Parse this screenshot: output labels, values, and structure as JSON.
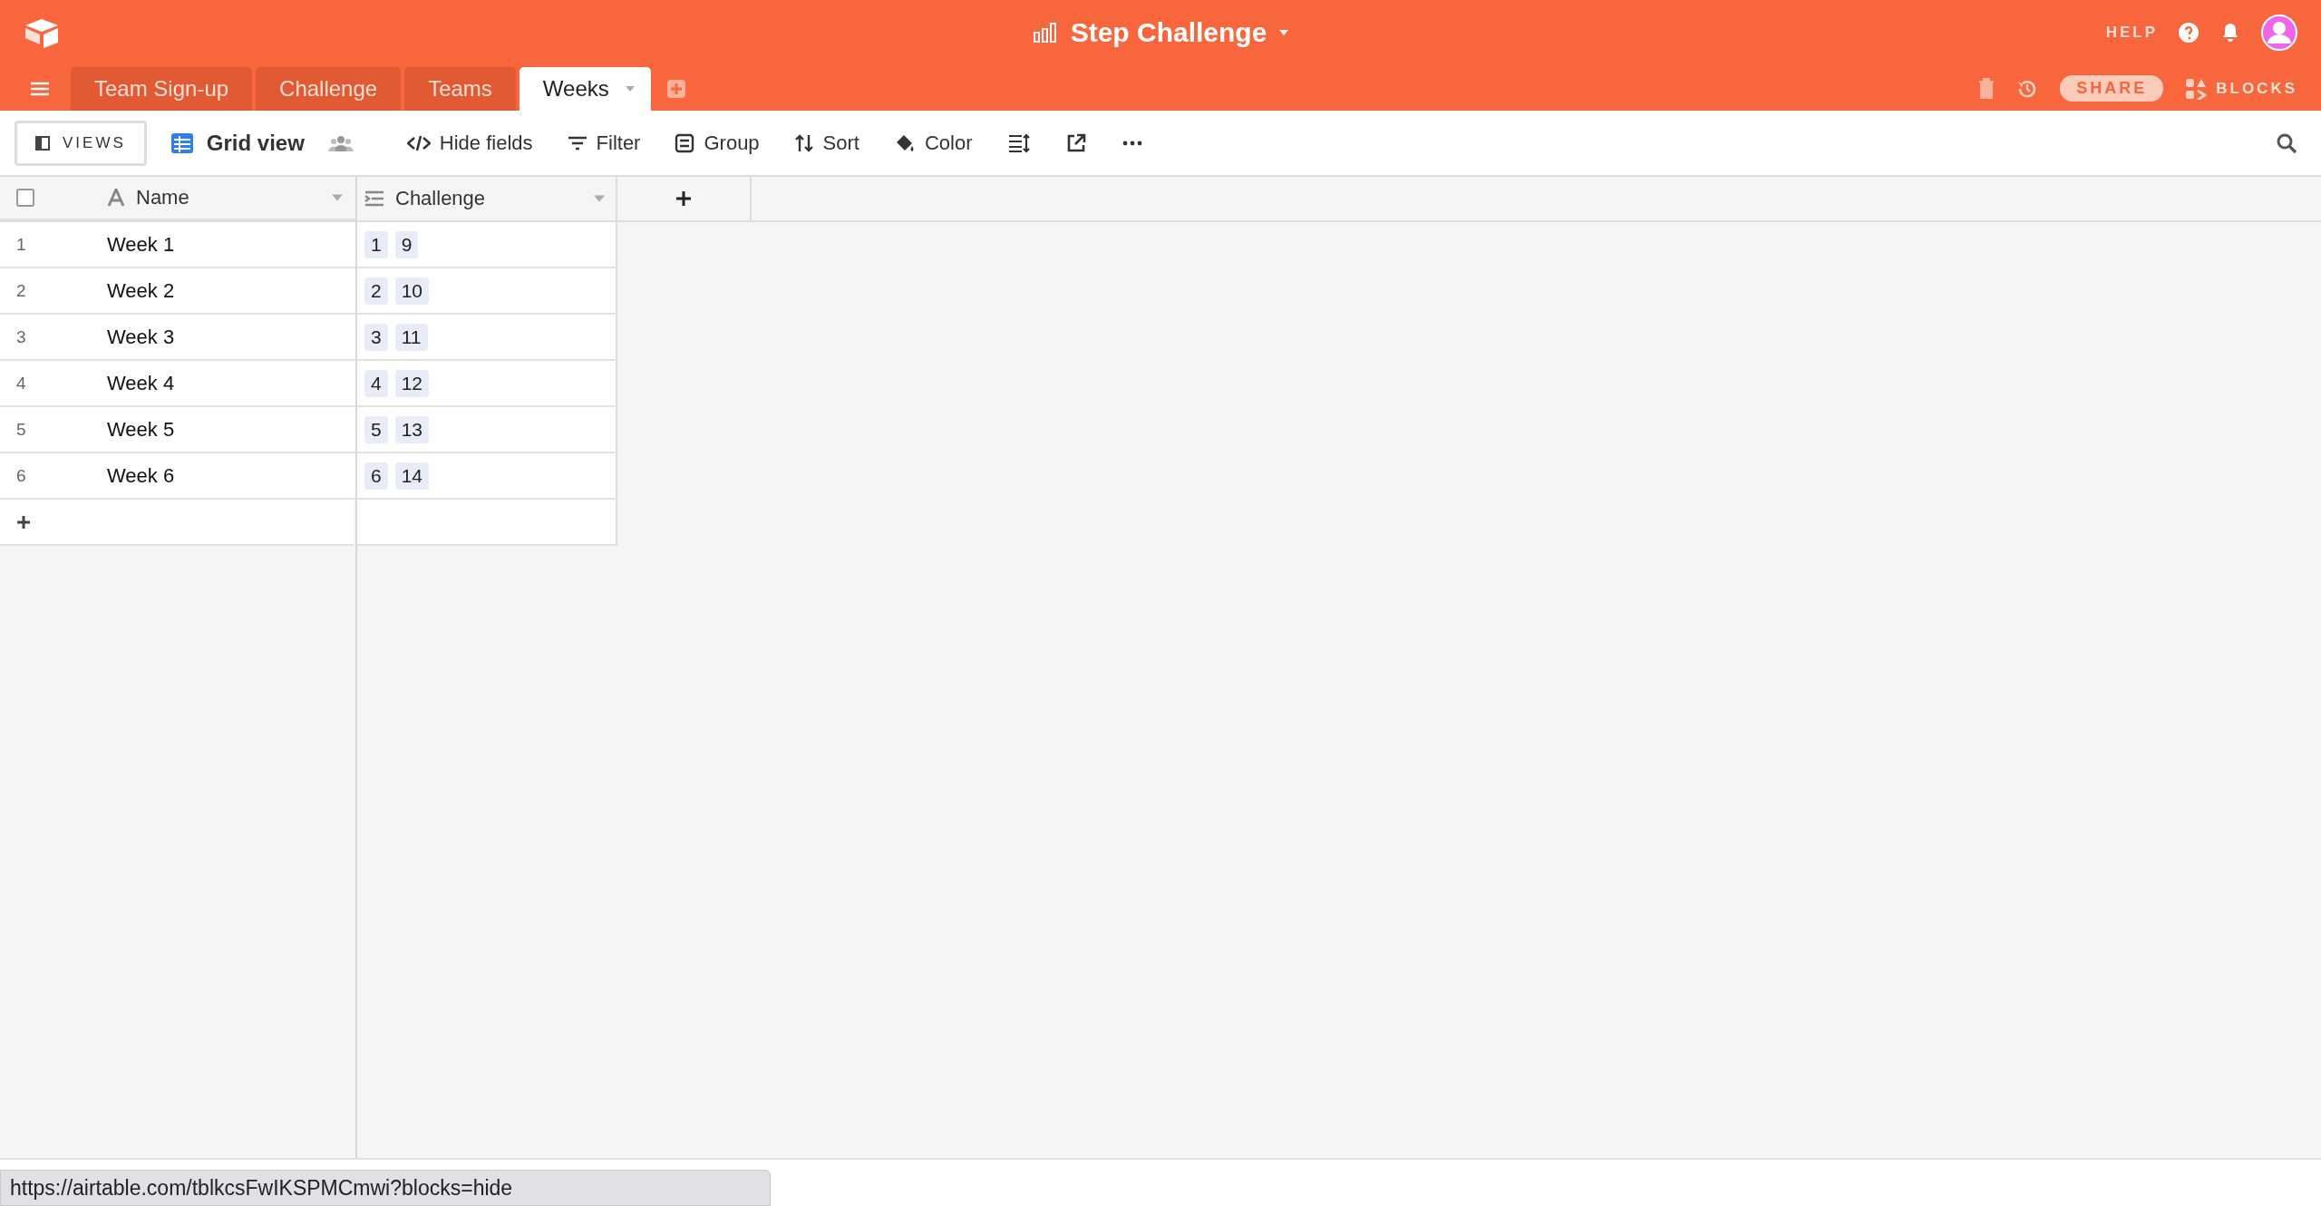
{
  "base": {
    "title": "Step Challenge"
  },
  "top_links": {
    "help": "HELP",
    "share": "SHARE",
    "blocks": "BLOCKS"
  },
  "tabs": [
    {
      "label": "Team Sign-up",
      "selected": false
    },
    {
      "label": "Challenge",
      "selected": false
    },
    {
      "label": "Teams",
      "selected": false
    },
    {
      "label": "Weeks",
      "selected": true
    }
  ],
  "toolbar": {
    "views": "VIEWS",
    "view_name": "Grid view",
    "items": [
      {
        "kind": "hide",
        "label": "Hide fields"
      },
      {
        "kind": "filter",
        "label": "Filter"
      },
      {
        "kind": "group",
        "label": "Group"
      },
      {
        "kind": "sort",
        "label": "Sort"
      },
      {
        "kind": "color",
        "label": "Color"
      }
    ]
  },
  "table": {
    "all_selected": false,
    "columns": [
      {
        "kind": "text",
        "label": "Name"
      },
      {
        "kind": "link",
        "label": "Challenge"
      }
    ],
    "rows": [
      {
        "number": "1",
        "name": "Week 1",
        "links": [
          "1",
          "9"
        ]
      },
      {
        "number": "2",
        "name": "Week 2",
        "links": [
          "2",
          "10"
        ]
      },
      {
        "number": "3",
        "name": "Week 3",
        "links": [
          "3",
          "11"
        ]
      },
      {
        "number": "4",
        "name": "Week 4",
        "links": [
          "4",
          "12"
        ]
      },
      {
        "number": "5",
        "name": "Week 5",
        "links": [
          "5",
          "13"
        ]
      },
      {
        "number": "6",
        "name": "Week 6",
        "links": [
          "6",
          "14"
        ]
      }
    ]
  },
  "status_bar": {
    "url": "https://airtable.com/tblkcsFwIKSPMCmwi?blocks=hide"
  }
}
